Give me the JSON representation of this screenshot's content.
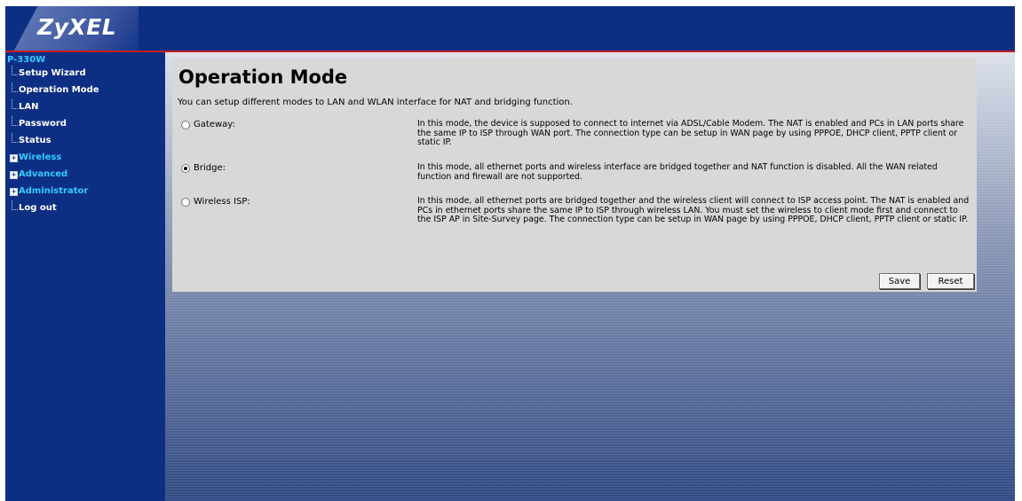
{
  "header": {
    "logo_text": "ZyXEL"
  },
  "sidebar": {
    "model": "P-330W",
    "items": [
      {
        "label": "Setup Wizard"
      },
      {
        "label": "Operation Mode"
      },
      {
        "label": "LAN"
      },
      {
        "label": "Password"
      },
      {
        "label": "Status"
      },
      {
        "label": "Wireless"
      },
      {
        "label": "Advanced"
      },
      {
        "label": "Administrator"
      },
      {
        "label": "Log out"
      }
    ]
  },
  "main": {
    "title": "Operation Mode",
    "intro": "You can setup different modes to LAN and WLAN interface for NAT and bridging function.",
    "modes": [
      {
        "label": "Gateway:",
        "checked": false,
        "description": "In this mode, the device is supposed to connect to internet via ADSL/Cable Modem. The NAT is enabled and PCs in LAN ports share the same IP to ISP through WAN port. The connection type can be setup in WAN page by using PPPOE, DHCP client, PPTP client or static IP."
      },
      {
        "label": "Bridge:",
        "checked": true,
        "description": "In this mode, all ethernet ports and wireless interface are bridged together and NAT function is disabled. All the WAN related function and firewall are not supported."
      },
      {
        "label": "Wireless ISP:",
        "checked": false,
        "description": "In this mode, all ethernet ports are bridged together and the wireless client will connect to ISP access point. The NAT is enabled and PCs in ethernet ports share the same IP to ISP through wireless LAN. You must set the wireless to client mode first and connect to the ISP AP in Site-Survey page. The connection type can be setup in WAN page by using PPPOE, DHCP client, PPTP client or static IP."
      }
    ],
    "save_label": "Save",
    "reset_label": "Reset"
  },
  "colors": {
    "header_bg": "#0d2f83",
    "header_accent": "#c81e1e",
    "sidebar_folder": "#33ccff",
    "panel_bg": "#d8d8d8"
  }
}
